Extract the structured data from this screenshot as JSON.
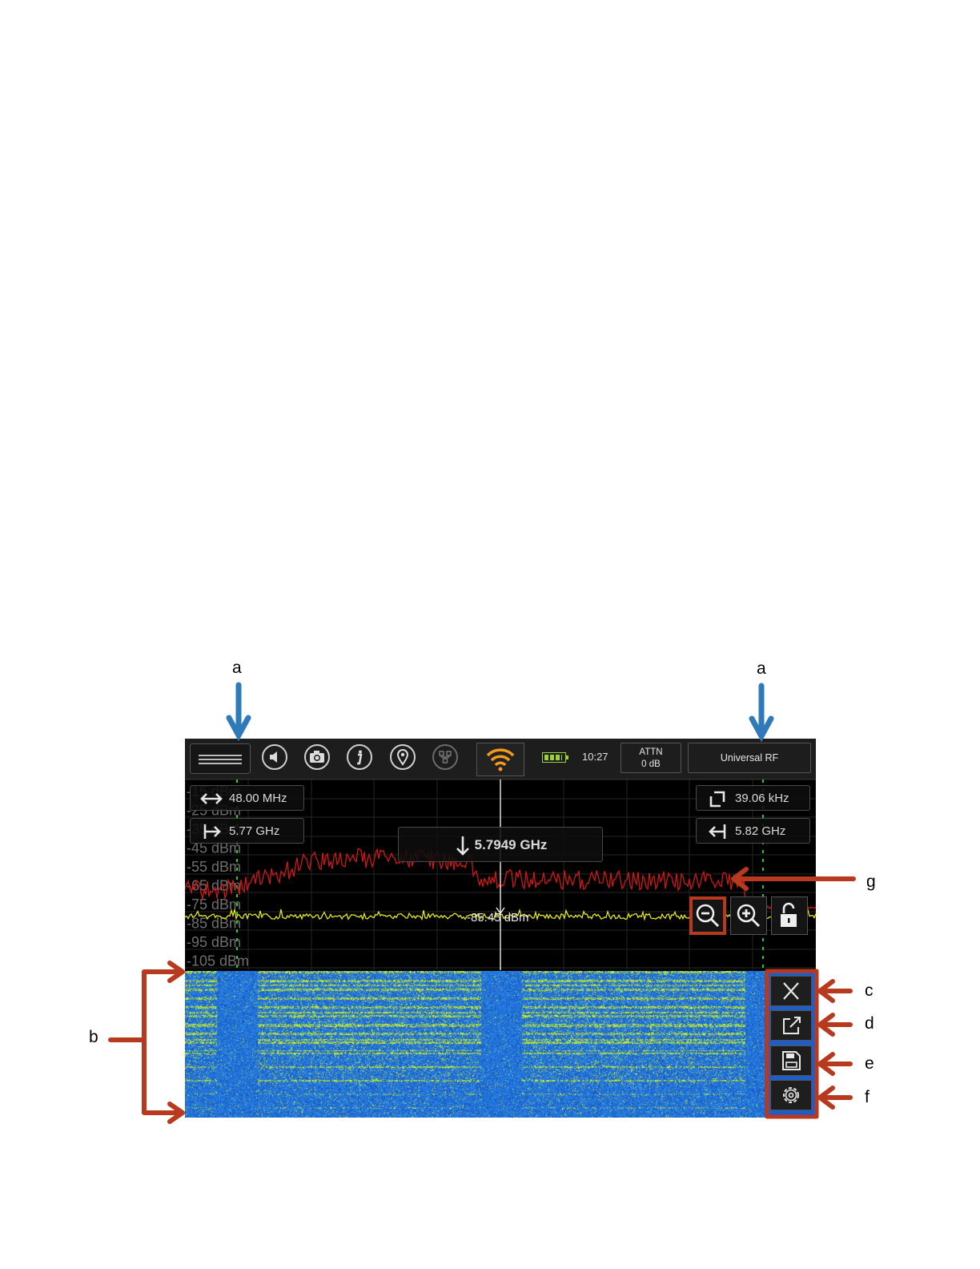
{
  "callouts": {
    "a_left": "a",
    "a_right": "a",
    "b": "b",
    "c": "c",
    "d": "d",
    "e": "e",
    "f": "f",
    "g": "g"
  },
  "toolbar": {
    "menu_icon": "hamburger-menu-icon",
    "icons": [
      "speaker-icon",
      "camera-icon",
      "info-icon",
      "location-pin-icon",
      "network-icon",
      "wifi-icon",
      "battery-icon"
    ],
    "clock": "10:27",
    "attn_label": "ATTN",
    "attn_value": "0 dB",
    "mode": "Universal RF"
  },
  "spectrum": {
    "span": "48.00 MHz",
    "start_freq": "5.77 GHz",
    "center_freq": "5.7949 GHz",
    "rbw": "39.06 kHz",
    "stop_freq": "5.82 GHz",
    "marker_level": "-85.45 dBm",
    "y_axis_labels": [
      "-15 dBm",
      "-25 dBm",
      "-35 dBm",
      "-45 dBm",
      "-55 dBm",
      "-65 dBm",
      "-75 dBm",
      "-85 dBm",
      "-95 dBm",
      "-105 dBm"
    ],
    "controls": [
      "zoom-out-icon",
      "zoom-in-icon",
      "unlock-icon"
    ]
  },
  "waterfall": {
    "buttons": [
      "close-icon",
      "export-icon",
      "save-icon",
      "settings-icon"
    ]
  },
  "colors": {
    "callout_blue": "#2f7ab8",
    "callout_red": "#b83a1e",
    "max_hold_trace": "#d01818",
    "live_trace": "#e6e619",
    "waterfall_bg": "#1e5cc8",
    "waterfall_signal": "#8ee020"
  }
}
